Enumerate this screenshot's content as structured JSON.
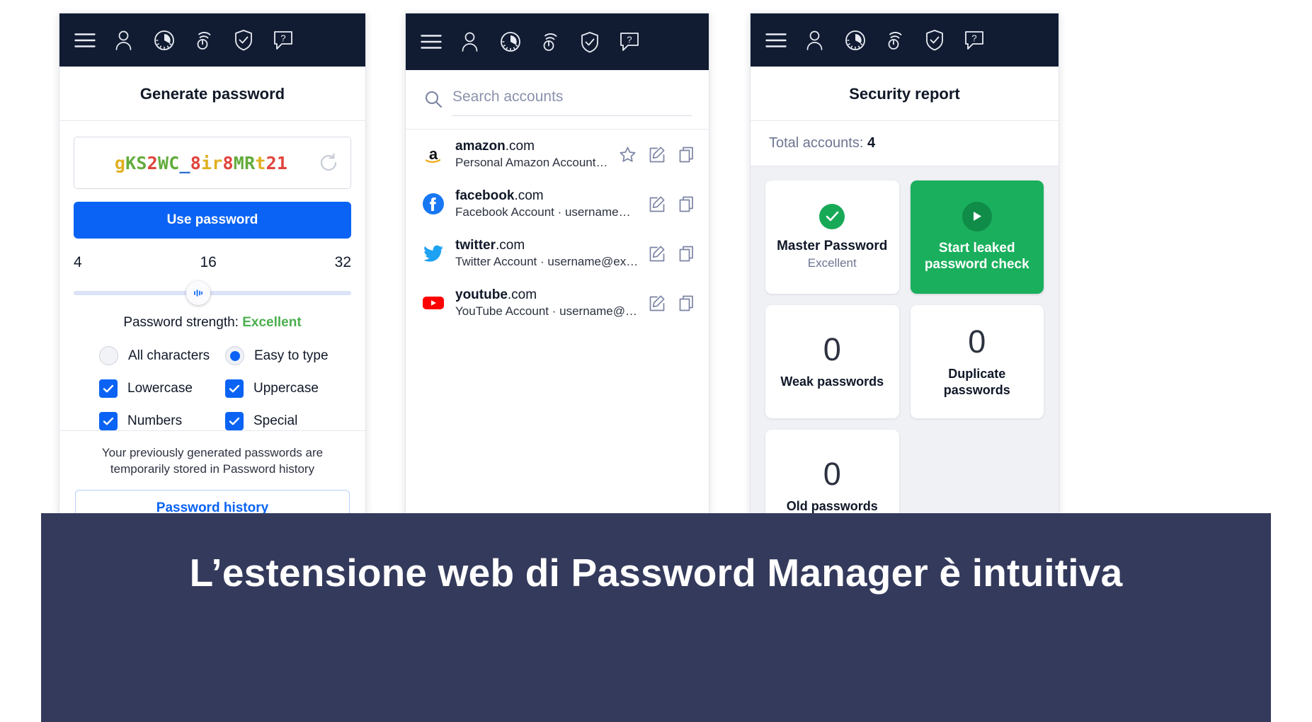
{
  "toolbar": {
    "icons": [
      {
        "name": "hamburger-menu-icon",
        "label": "Menu"
      },
      {
        "name": "user-account-icon",
        "label": "My account"
      },
      {
        "name": "dashboard-gauge-icon",
        "label": "Dashboard"
      },
      {
        "name": "wifi-security-icon",
        "label": "Wi-Fi security"
      },
      {
        "name": "shield-check-icon",
        "label": "Security report"
      },
      {
        "name": "help-question-icon",
        "label": "Help"
      }
    ]
  },
  "generate_panel": {
    "title": "Generate password",
    "password": {
      "value": "gKS2WC_8ir8MRt21",
      "chars": [
        {
          "c": "g",
          "color": "#e0b020"
        },
        {
          "c": "K",
          "color": "#63ac3c"
        },
        {
          "c": "S",
          "color": "#63ac3c"
        },
        {
          "c": "2",
          "color": "#e0443c"
        },
        {
          "c": "W",
          "color": "#63ac3c"
        },
        {
          "c": "C",
          "color": "#63ac3c"
        },
        {
          "c": "_",
          "color": "#2f6fd0"
        },
        {
          "c": "8",
          "color": "#e0443c"
        },
        {
          "c": "i",
          "color": "#e0b020"
        },
        {
          "c": "r",
          "color": "#e0b020"
        },
        {
          "c": "8",
          "color": "#e0443c"
        },
        {
          "c": "M",
          "color": "#63ac3c"
        },
        {
          "c": "R",
          "color": "#63ac3c"
        },
        {
          "c": "t",
          "color": "#e0b020"
        },
        {
          "c": "2",
          "color": "#e0443c"
        },
        {
          "c": "1",
          "color": "#e0443c"
        }
      ],
      "refresh_icon": "refresh-icon"
    },
    "use_password_label": "Use password",
    "length": {
      "min": "4",
      "current": "16",
      "max": "32",
      "thumb_percent": 45
    },
    "strength_label": "Password strength:",
    "strength_value": "Excellent",
    "strength_color": "#4caf50",
    "charset_options": [
      {
        "label": "All characters",
        "selected": false
      },
      {
        "label": "Easy to type",
        "selected": true
      }
    ],
    "checkboxes": [
      {
        "label": "Lowercase",
        "checked": true
      },
      {
        "label": "Uppercase",
        "checked": true
      },
      {
        "label": "Numbers",
        "checked": true
      },
      {
        "label": "Special",
        "checked": true
      }
    ],
    "history_note": "Your previously generated passwords are temporarily stored in Password history",
    "history_button": "Password history"
  },
  "accounts_panel": {
    "search_placeholder": "Search accounts",
    "search_value": "",
    "accounts": [
      {
        "brand": "amazon",
        "tld": ".com",
        "subtitle": "Personal Amazon Account · us…",
        "logo": "amazon-logo-icon",
        "favorited": false,
        "has_star": true
      },
      {
        "brand": "facebook",
        "tld": ".com",
        "subtitle": "Facebook Account · username@exa…",
        "logo": "facebook-logo-icon",
        "favorited": false,
        "has_star": false
      },
      {
        "brand": "twitter",
        "tld": ".com",
        "subtitle": "Twitter Account · username@exampl…",
        "logo": "twitter-logo-icon",
        "favorited": false,
        "has_star": false
      },
      {
        "brand": "youtube",
        "tld": ".com",
        "subtitle": "YouTube Account · username@exam…",
        "logo": "youtube-logo-icon",
        "favorited": false,
        "has_star": false
      }
    ],
    "row_action_icons": [
      "star-icon",
      "edit-pencil-icon",
      "copy-icon"
    ]
  },
  "security_panel": {
    "title": "Security report",
    "total_label": "Total accounts:",
    "total_value": "4",
    "cards": [
      {
        "kind": "status",
        "icon": "check-circle-icon",
        "title": "Master Password",
        "subtitle": "Excellent",
        "accent": "#18a957"
      },
      {
        "kind": "action",
        "icon": "play-circle-icon",
        "title": "Start leaked password check",
        "accent": "#1aaf5d"
      },
      {
        "kind": "count",
        "number": "0",
        "label": "Weak passwords"
      },
      {
        "kind": "count",
        "number": "0",
        "label": "Duplicate passwords"
      },
      {
        "kind": "count",
        "number": "0",
        "label": "Old passwords"
      }
    ]
  },
  "caption": {
    "text": "L’estensione web di Password Manager è intuitiva",
    "background": "#343a5c",
    "color": "#ffffff"
  }
}
